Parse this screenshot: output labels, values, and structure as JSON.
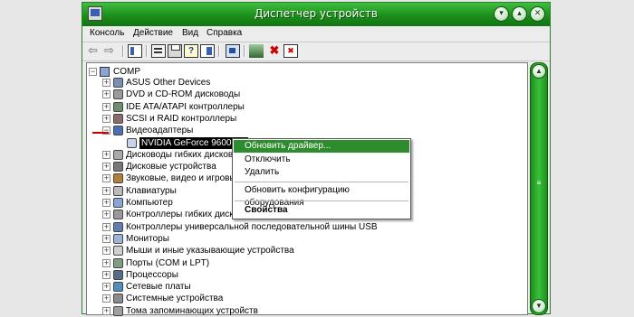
{
  "window": {
    "title": "Диспетчер устройств",
    "controls": [
      "minimize",
      "maximize",
      "close"
    ]
  },
  "menu": [
    "Консоль",
    "Действие",
    "Вид",
    "Справка"
  ],
  "toolbar_icons": [
    "back-icon",
    "forward-icon",
    "console-tree-icon",
    "properties-icon",
    "print-icon",
    "help-icon",
    "show-hide-icon",
    "scan-hardware-icon",
    "update-driver-icon",
    "uninstall-icon",
    "disable-icon"
  ],
  "tree": {
    "root": "COMP",
    "items": [
      {
        "label": "ASUS Other Devices",
        "icon": "device-icon",
        "expand": "+"
      },
      {
        "label": "DVD и CD-ROM дисководы",
        "icon": "cdrom-icon",
        "expand": "+"
      },
      {
        "label": "IDE ATA/ATAPI контроллеры",
        "icon": "ide-controller-icon",
        "expand": "+"
      },
      {
        "label": "SCSI и RAID контроллеры",
        "icon": "scsi-icon",
        "expand": "+"
      },
      {
        "label": "Видеоадаптеры",
        "icon": "display-adapter-icon",
        "expand": "−"
      },
      {
        "label": "NVIDIA GeForce 9600 GT",
        "icon": "monitor-icon",
        "expand": "",
        "child": true,
        "selected": true
      },
      {
        "label": "Дисководы гибких дисков",
        "icon": "floppy-icon",
        "expand": "+"
      },
      {
        "label": "Дисковые устройства",
        "icon": "disk-drive-icon",
        "expand": "+"
      },
      {
        "label": "Звуковые, видео и игровые устройства",
        "icon": "sound-icon",
        "expand": "+"
      },
      {
        "label": "Клавиатуры",
        "icon": "keyboard-icon",
        "expand": "+"
      },
      {
        "label": "Компьютер",
        "icon": "computer-icon",
        "expand": "+"
      },
      {
        "label": "Контроллеры гибких дисков",
        "icon": "floppy-controller-icon",
        "expand": "+"
      },
      {
        "label": "Контроллеры универсальной последовательной шины USB",
        "icon": "usb-icon",
        "expand": "+"
      },
      {
        "label": "Мониторы",
        "icon": "monitor-icon",
        "expand": "+"
      },
      {
        "label": "Мыши и иные указывающие устройства",
        "icon": "mouse-icon",
        "expand": "+"
      },
      {
        "label": "Порты (COM и LPT)",
        "icon": "port-icon",
        "expand": "+"
      },
      {
        "label": "Процессоры",
        "icon": "processor-icon",
        "expand": "+"
      },
      {
        "label": "Сетевые платы",
        "icon": "network-icon",
        "expand": "+"
      },
      {
        "label": "Системные устройства",
        "icon": "system-icon",
        "expand": "+"
      },
      {
        "label": "Тома запоминающих устройств",
        "icon": "storage-icon",
        "expand": "+"
      }
    ]
  },
  "context_menu": {
    "items": [
      {
        "label": "Обновить драйвер...",
        "highlighted": true
      },
      {
        "label": "Отключить"
      },
      {
        "label": "Удалить"
      },
      {
        "label": "Обновить конфигурацию оборудования"
      },
      {
        "label": "Свойства",
        "bold": true
      }
    ]
  },
  "colors": {
    "title_green": "#1b8f1b",
    "highlight": "#2e8b2e",
    "selection": "#000000",
    "annotation_red": "#c80000"
  }
}
